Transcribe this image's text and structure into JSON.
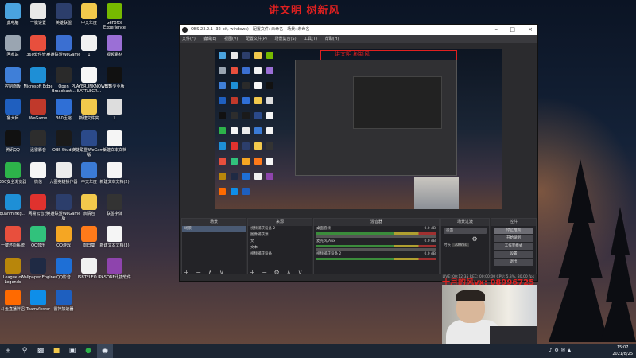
{
  "caption": "讲文明 树新风",
  "desktop_icons": [
    {
      "label": "此电脑",
      "color": "#4aa3df"
    },
    {
      "label": "一键设置",
      "color": "#e8e8e8"
    },
    {
      "label": "英雄联盟",
      "color": "#2c3e6b"
    },
    {
      "label": "中文年度",
      "color": "#f2c94c"
    },
    {
      "label": "GeForce Experience",
      "color": "#76b900"
    },
    {
      "label": "回收站",
      "color": "#9aa5b1"
    },
    {
      "label": "360软件管家",
      "color": "#e84f3d"
    },
    {
      "label": "英雄联盟WeGame",
      "color": "#3b6fd1"
    },
    {
      "label": "1",
      "color": "#f1f1f1"
    },
    {
      "label": "视频素材",
      "color": "#9b6fd6"
    },
    {
      "label": "控制面板",
      "color": "#3f7fd8"
    },
    {
      "label": "Microsoft Edge",
      "color": "#1e8fd6"
    },
    {
      "label": "Open Broadcast...",
      "color": "#2a2a2a"
    },
    {
      "label": "PLAYERUNKNOWN'S BATTLEGR...",
      "color": "#f7f7f7"
    },
    {
      "label": "剪映专业版",
      "color": "#111111"
    },
    {
      "label": "鲁大师",
      "color": "#1f5fbf"
    },
    {
      "label": "WeGame",
      "color": "#c0392b"
    },
    {
      "label": "360压缩",
      "color": "#2f6fd6"
    },
    {
      "label": "新建文件夹",
      "color": "#f2c94c"
    },
    {
      "label": "1",
      "color": "#dddddd"
    },
    {
      "label": "腾讯QQ",
      "color": "#111111"
    },
    {
      "label": "迅雷影音",
      "color": "#2d2d2d"
    },
    {
      "label": "OBS Studio",
      "color": "#1a1a1a"
    },
    {
      "label": "英雄联盟WeGame版",
      "color": "#2b4a8a"
    },
    {
      "label": "新建文本文档",
      "color": "#f5f5f5"
    },
    {
      "label": "360安全浏览器",
      "color": "#2db34a"
    },
    {
      "label": "微信",
      "color": "#f5f5f5"
    },
    {
      "label": "六图英雄操作器",
      "color": "#ececec"
    },
    {
      "label": "中文年度",
      "color": "#3b7bd6"
    },
    {
      "label": "新建文本文档(2)",
      "color": "#f5f5f5"
    },
    {
      "label": "quanminkg...",
      "color": "#1e8fd6"
    },
    {
      "label": "网易云音乐",
      "color": "#e0322e"
    },
    {
      "label": "英雄联盟WeGame版",
      "color": "#2c3e6b"
    },
    {
      "label": "表情包",
      "color": "#f2c94c"
    },
    {
      "label": "联盟字体",
      "color": "#333333"
    },
    {
      "label": "一键还原系统",
      "color": "#e84f3d"
    },
    {
      "label": "QQ音乐",
      "color": "#31c27c"
    },
    {
      "label": "QQ游戏",
      "color": "#f5a623"
    },
    {
      "label": "向日葵",
      "color": "#ff7a1a"
    },
    {
      "label": "新建文本文档(3)",
      "color": "#f5f5f5"
    },
    {
      "label": "League of Legends",
      "color": "#b8860b"
    },
    {
      "label": "Wallpaper Engine",
      "color": "#1f2a44"
    },
    {
      "label": "QQ影音",
      "color": "#1e6fd6"
    },
    {
      "label": "ISBTFLEO...",
      "color": "#f1f1f1"
    },
    {
      "label": "IPASONE讯捷软件",
      "color": "#8e44ad"
    },
    {
      "label": "斗鱼直播伴侣",
      "color": "#ff6a00"
    },
    {
      "label": "TeamViewer",
      "color": "#0e8ee9"
    },
    {
      "label": "雷神加速器",
      "color": "#1e5fbf"
    }
  ],
  "obs": {
    "title": "OBS 23.2.1 (32-bit, windows) - 配置文件: 未命名 - 场景: 未命名",
    "menus": [
      "文件(F)",
      "编辑(E)",
      "视图(V)",
      "配置文件(P)",
      "场景集合(S)",
      "工具(T)",
      "帮助(H)"
    ],
    "inner_caption": "讲文明 树新风",
    "panels": {
      "scenes": {
        "title": "场景",
        "items": [
          "场景"
        ]
      },
      "sources": {
        "title": "来源",
        "items": [
          "视频捕获设备 2",
          "图像捕获源",
          "文",
          "文本",
          "视频捕获设备"
        ]
      },
      "mixer": {
        "title": "混音器",
        "channels": [
          {
            "name": "桌面音频",
            "db": "0.0 dB"
          },
          {
            "name": "麦克风/Aux",
            "db": "0.0 dB"
          },
          {
            "name": "视频捕获设备 2",
            "db": "0.0 dB"
          }
        ]
      },
      "transitions": {
        "title": "场景过渡",
        "type": "淡出",
        "duration_label": "时长",
        "duration": "300ms"
      },
      "controls": {
        "title": "控件",
        "buttons": [
          "停止推流",
          "开始录制",
          "工作室模式",
          "设置",
          "退出"
        ]
      }
    },
    "status": "LIVE: 00:12:35  REC: 00:00:00  CPU: 5.3%, 30.00 fps"
  },
  "stream_banner": "十月的风vx: 08996725",
  "taskbar": {
    "time": "15:07",
    "date": "2021/8/25"
  }
}
